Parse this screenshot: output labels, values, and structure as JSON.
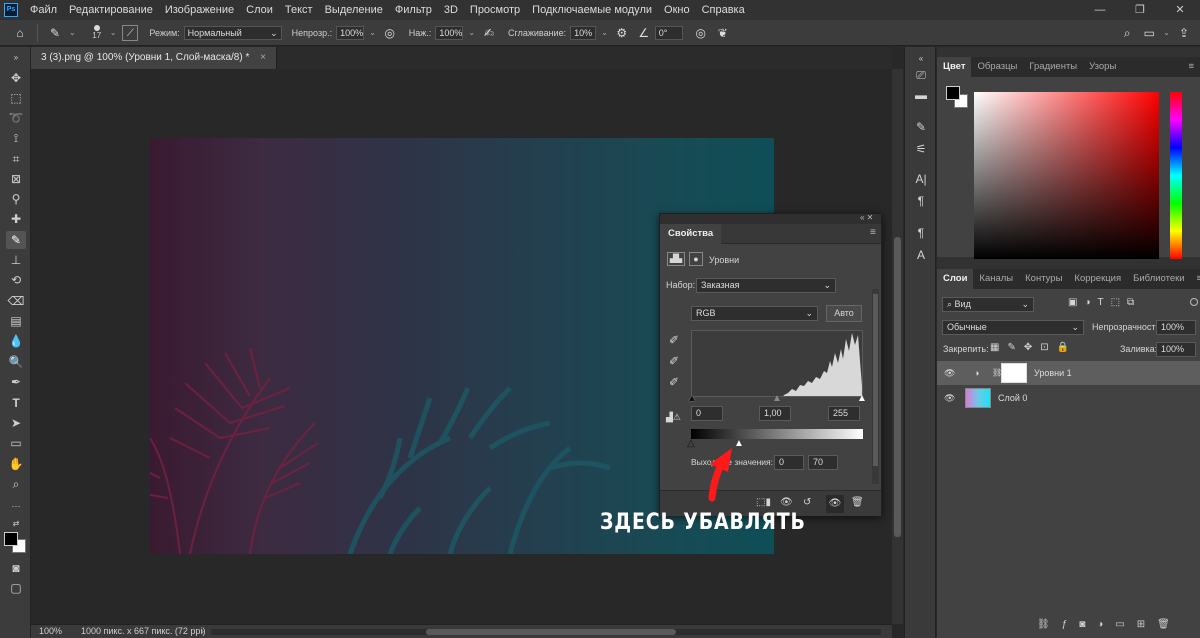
{
  "app": {
    "logo": "Ps"
  },
  "menu": [
    "Файл",
    "Редактирование",
    "Изображение",
    "Слои",
    "Текст",
    "Выделение",
    "Фильтр",
    "3D",
    "Просмотр",
    "Подключаемые модули",
    "Окно",
    "Справка"
  ],
  "window_controls": [
    "—",
    "❐",
    "✕"
  ],
  "options": {
    "brush_size": "17",
    "mode_label": "Режим:",
    "mode_value": "Нормальный",
    "opacity_label": "Непрозр.:",
    "opacity_value": "100%",
    "pressure_label": "Наж.:",
    "pressure_value": "100%",
    "smoothing_label": "Сглаживание:",
    "smoothing_value": "10%",
    "angle_value": "0°"
  },
  "document": {
    "tab_title": "3 (3).png @ 100% (Уровни 1, Слой-маска/8) *",
    "tab_close": "×",
    "zoom": "100%",
    "doc_info": "1000 пикс. x 667 пикс. (72 ppi)",
    "status_arrow": "›"
  },
  "properties": {
    "title": "Свойства",
    "adjustment": "Уровни",
    "preset_label": "Набор:",
    "preset_value": "Заказная",
    "channel": "RGB",
    "auto_label": "Авто",
    "input_black": "0",
    "input_gamma": "1,00",
    "input_white": "255",
    "output_label": "Выходные значения:",
    "output_black": "0",
    "output_white": "70",
    "input_levels": {
      "black": 0,
      "gamma": 1.0,
      "white": 255
    },
    "output_levels": {
      "black": 0,
      "white": 70
    }
  },
  "color_panel": {
    "tabs": [
      "Цвет",
      "Образцы",
      "Градиенты",
      "Узоры"
    ],
    "foreground": "#000000",
    "background": "#ffffff"
  },
  "layers_panel": {
    "tabs": [
      "Слои",
      "Каналы",
      "Контуры",
      "Коррекция",
      "Библиотеки"
    ],
    "filter_value": "Вид",
    "blend_mode": "Обычные",
    "opacity_label": "Непрозрачность:",
    "opacity_value": "100%",
    "lock_label": "Закрепить:",
    "fill_label": "Заливка:",
    "fill_value": "100%",
    "layers": [
      {
        "name": "Уровни 1",
        "selected": true,
        "visible": true
      },
      {
        "name": "Слой 0",
        "selected": false,
        "visible": true
      }
    ]
  },
  "annotation": {
    "text": "ЗДЕСЬ УБАВЛЯТЬ",
    "color": "#ff1a1a"
  },
  "colors": {
    "accent": "#31a8ff",
    "arrow": "#ff1a1a"
  }
}
